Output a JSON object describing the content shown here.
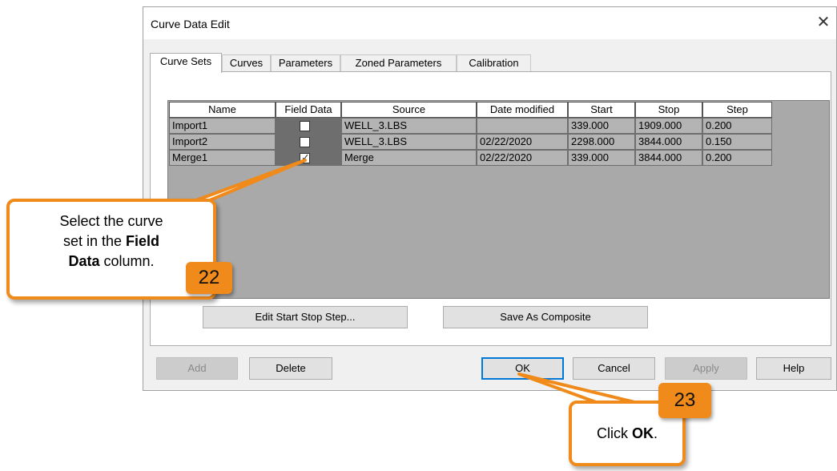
{
  "dialog": {
    "title": "Curve Data Edit",
    "close_glyph": "✕"
  },
  "tabs": [
    "Curve Sets",
    "Curves",
    "Parameters",
    "Zoned Parameters",
    "Calibration"
  ],
  "table": {
    "columns": [
      "Name",
      "Field Data",
      "Source",
      "Date modified",
      "Start",
      "Stop",
      "Step"
    ],
    "rows": [
      {
        "name": "Import1",
        "field_data": false,
        "source": "WELL_3.LBS",
        "date": "",
        "start": "339.000",
        "stop": "1909.000",
        "step": "0.200"
      },
      {
        "name": "Import2",
        "field_data": false,
        "source": "WELL_3.LBS",
        "date": "02/22/2020",
        "start": "2298.000",
        "stop": "3844.000",
        "step": "0.150"
      },
      {
        "name": "Merge1",
        "field_data": true,
        "source": "Merge",
        "date": "02/22/2020",
        "start": "339.000",
        "stop": "3844.000",
        "step": "0.200"
      }
    ]
  },
  "panel_buttons": {
    "edit": "Edit Start Stop Step...",
    "save": "Save As Composite"
  },
  "footer_buttons": {
    "add": "Add",
    "delete": "Delete",
    "ok": "OK",
    "cancel": "Cancel",
    "apply": "Apply",
    "help": "Help"
  },
  "callouts": {
    "c22": {
      "line1": "Select the curve",
      "line2": "set in the",
      "bold1": "Field",
      "bold2": "Data",
      "line3": "column.",
      "number": "22"
    },
    "c23": {
      "prefix": "Click",
      "bold": "OK",
      "suffix": ".",
      "number": "23"
    }
  },
  "colors": {
    "accent_orange": "#f08a1a",
    "default_button_border": "#0078d7"
  }
}
